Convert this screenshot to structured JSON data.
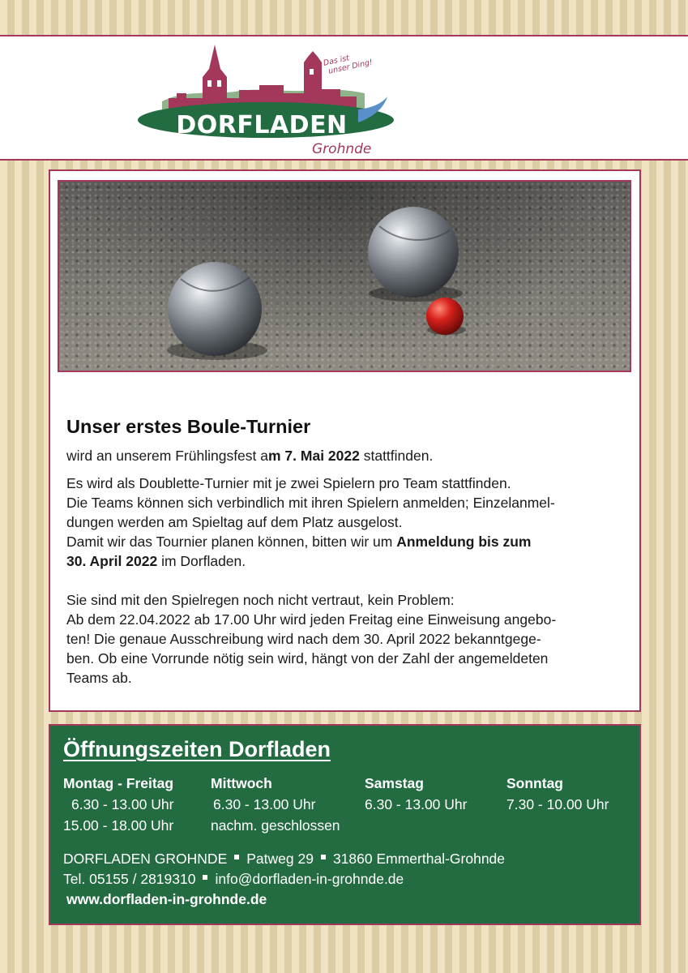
{
  "header": {
    "logo_name": "DORFLADEN",
    "logo_sub": "Grohnde",
    "logo_slogan_1": "Das ist",
    "logo_slogan_2": "unser Ding!",
    "colors": {
      "brand_red": "#a3385a",
      "brand_green": "#236b41",
      "river_blue": "#5b8fc9",
      "hill_green": "#8fb38a"
    }
  },
  "photo": {
    "subject": "boule-balls-on-gravel"
  },
  "article": {
    "title": "Unser erstes Boule-Turnier",
    "intro_prefix": "wird an unserem Frühlingsfest a",
    "intro_bold": "m 7. Mai 2022",
    "intro_suffix": " stattfinden.",
    "p2_line1": "Es wird als Doublette-Turnier mit je zwei Spielern pro Team stattfinden.",
    "p2_line2": "Die Teams können sich verbindlich mit ihren Spielern anmelden; Einzelanmel-",
    "p2_line3": "dungen werden am Spieltag auf dem Platz ausgelost.",
    "p2_line4_prefix": "Damit wir das Tournier planen können, bitten wir um ",
    "p2_line4_bold": "Anmeldung bis zum",
    "p2_line5_bold": "30. April 2022",
    "p2_line5_suffix": " im Dorfladen.",
    "p3_line1": "Sie sind mit den Spielregen noch nicht vertraut, kein Problem:",
    "p3_line2": "Ab dem 22.04.2022 ab 17.00 Uhr wird jeden Freitag eine Einweisung angebo-",
    "p3_line3": "ten! Die genaue Ausschreibung wird nach dem 30. April 2022 bekanntgege-",
    "p3_line4": "ben. Ob eine Vorrunde nötig sein wird, hängt von der Zahl der angemeldeten",
    "p3_line5": "Teams ab."
  },
  "hours": {
    "title": "Öffnungszeiten Dorfladen",
    "columns": [
      {
        "day": "Montag - Freitag",
        "line1": "6.30 - 13.00 Uhr",
        "line2": "15.00 - 18.00 Uhr"
      },
      {
        "day": "Mittwoch",
        "line1": "6.30 - 13.00 Uhr",
        "line2": "nachm. geschlossen"
      },
      {
        "day": "Samstag",
        "line1": "6.30 - 13.00 Uhr",
        "line2": ""
      },
      {
        "day": "Sonntag",
        "line1": "7.30 - 10.00 Uhr",
        "line2": ""
      }
    ]
  },
  "contact": {
    "name": "DORFLADEN GROHNDE",
    "street": "Patweg 29",
    "city": "31860 Emmerthal-Grohnde",
    "phone": "Tel. 05155 / 2819310",
    "email": "info@dorfladen-in-grohnde.de",
    "website": "www.dorfladen-in-grohnde.de"
  }
}
